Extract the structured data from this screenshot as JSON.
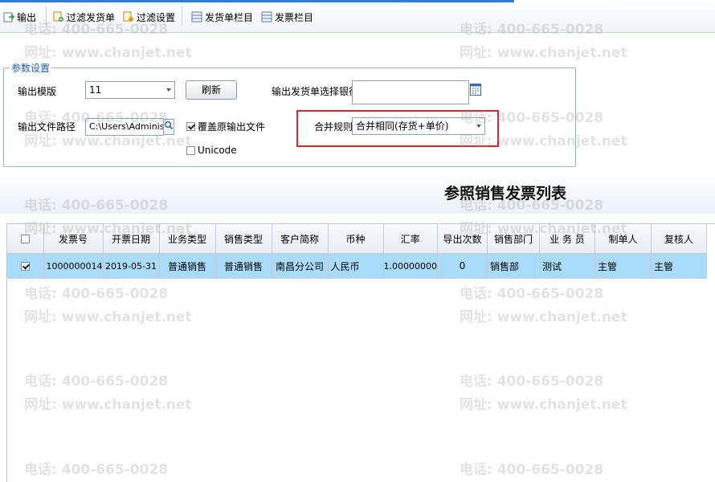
{
  "toolbar": {
    "output": "输出",
    "filter_docs": "过滤发货单",
    "filter_settings": "过滤设置",
    "shipment_columns": "发货单栏目",
    "invoice_columns": "发票栏目"
  },
  "params": {
    "group_title": "参数设置",
    "template_label": "输出模版",
    "template_value": "11",
    "refresh_button": "刷新",
    "bank_label": "输出发货单选择银行",
    "bank_value": "",
    "path_label": "输出文件路径",
    "path_value": "C:\\Users\\Administrato",
    "overwrite_label": "覆盖原输出文件",
    "overwrite_checked": true,
    "unicode_label": "Unicode",
    "unicode_checked": false,
    "merge_label": "合并规则",
    "merge_value": "合并相同(存货+单价)"
  },
  "list": {
    "title": "参照销售发票列表",
    "columns": [
      "发票号",
      "开票日期",
      "业务类型",
      "销售类型",
      "客户简称",
      "币种",
      "汇率",
      "导出次数",
      "销售部门",
      "业 务 员",
      "制单人",
      "复核人"
    ],
    "rows": [
      {
        "checked": true,
        "cells": [
          "1000000014",
          "2019-05-31",
          "普通销售",
          "普通销售",
          "南昌分公司",
          "人民币",
          "1.00000000",
          "0",
          "销售部",
          "测试",
          "主管",
          "主管"
        ]
      }
    ]
  },
  "watermark": {
    "phone": "电话: 400-665-0028",
    "site": "网址: www.chanjet.net"
  },
  "colors": {
    "accent": "#2f7bd8",
    "selected_row": "#a9dcfa",
    "highlight_box": "#e0252b",
    "group_title": "#1a5fb4"
  }
}
